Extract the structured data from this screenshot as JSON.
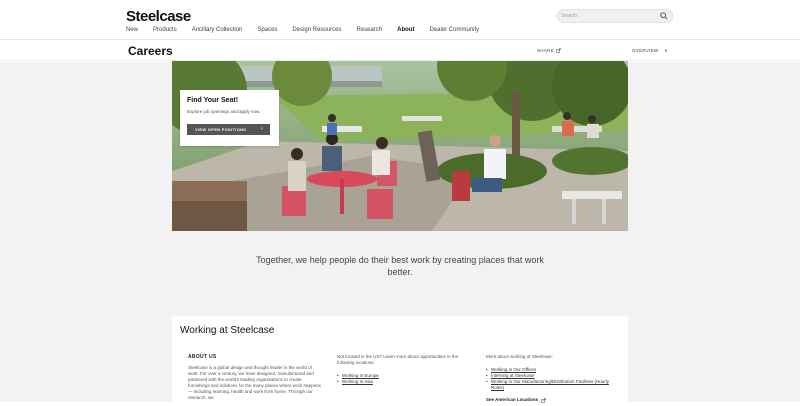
{
  "header": {
    "logo": "Steelcase",
    "search_placeholder": "Search",
    "nav": [
      "New",
      "Products",
      "Ancillary Collection",
      "Spaces",
      "Design Resources",
      "Research",
      "About",
      "Dealer Community"
    ],
    "active_nav": "About"
  },
  "subheader": {
    "title": "Careers",
    "share": "SHARE",
    "overview": "OVERVIEW"
  },
  "hero_card": {
    "title": "Find Your Seat!",
    "subtitle": "Explore job openings and apply now.",
    "button": "VIEW OPEN POSITIONS"
  },
  "tagline": "Together, we help people do their best work by creating places that work better.",
  "working": {
    "title": "Working at Steelcase",
    "about_heading": "ABOUT US",
    "about_text": "Steelcase is a global design and thought leader in the world of work. For over a century, we have designed, manufactured and partnered with the world's leading organizations to create furnishings and solutions for the many places where work happens — including learning, health and work from home. Through our research, we",
    "col2_text": "Not located in the US? Learn more about opportunities in the following locations:",
    "col2_links": [
      "Working in Europe",
      "Working in Asia"
    ],
    "col3_text": "More about working at Steelcase:",
    "col3_links": [
      "Working in Our Offices",
      "Interning at Steelcase",
      "Working in Our Manufacturing/Distribution Facilities (Hourly Roles)"
    ],
    "see_more": "See American Locations"
  },
  "colors": {
    "button": "#555555",
    "page_bg": "#f2f2f2"
  }
}
